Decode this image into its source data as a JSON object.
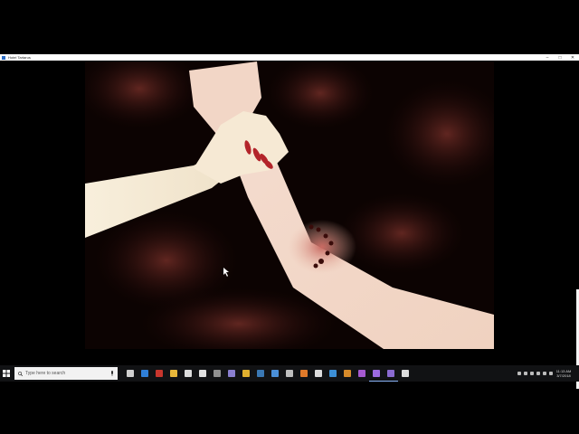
{
  "window": {
    "title": "Hotel Tartarus",
    "controls": [
      "–",
      "□",
      "✕"
    ]
  },
  "taskbar": {
    "search_placeholder": "Type here to search",
    "pinned_icons": [
      {
        "name": "task-view-icon",
        "color": "#cfcfcf"
      },
      {
        "name": "edge-icon",
        "color": "#2f7fd8"
      },
      {
        "name": "app-red-icon",
        "color": "#c8362d"
      },
      {
        "name": "file-explorer-icon",
        "color": "#e8b73a"
      },
      {
        "name": "store-icon",
        "color": "#dcdcdc"
      },
      {
        "name": "mail-icon",
        "color": "#e0e0e0"
      },
      {
        "name": "media-icon",
        "color": "#909090"
      },
      {
        "name": "app-purple-icon",
        "color": "#8a7fd0"
      },
      {
        "name": "chrome-icon",
        "color": "#e0b02f"
      },
      {
        "name": "steam-icon",
        "color": "#3a78b4"
      },
      {
        "name": "app-blue-icon",
        "color": "#4a8fd8"
      },
      {
        "name": "shield-icon",
        "color": "#bfbfbf"
      },
      {
        "name": "browser-icon",
        "color": "#e07a2a"
      },
      {
        "name": "monitor-icon",
        "color": "#dcdcdc"
      },
      {
        "name": "editor-icon",
        "color": "#3c8fd6"
      },
      {
        "name": "app-orange-icon",
        "color": "#d68a2a"
      },
      {
        "name": "app-violet-icon",
        "color": "#a65ad0"
      },
      {
        "name": "game-icon",
        "color": "#9d6be0"
      },
      {
        "name": "app-active-icon",
        "color": "#8a6ad0"
      },
      {
        "name": "settings-icon",
        "color": "#dcdcdc"
      }
    ],
    "tray_icons": [
      "pen-icon",
      "chevron-up-icon",
      "cloud-icon",
      "network-icon",
      "volume-icon",
      "keyboard-icon"
    ],
    "clock_time": "11:13 AM",
    "clock_date": "3/7/2018"
  }
}
